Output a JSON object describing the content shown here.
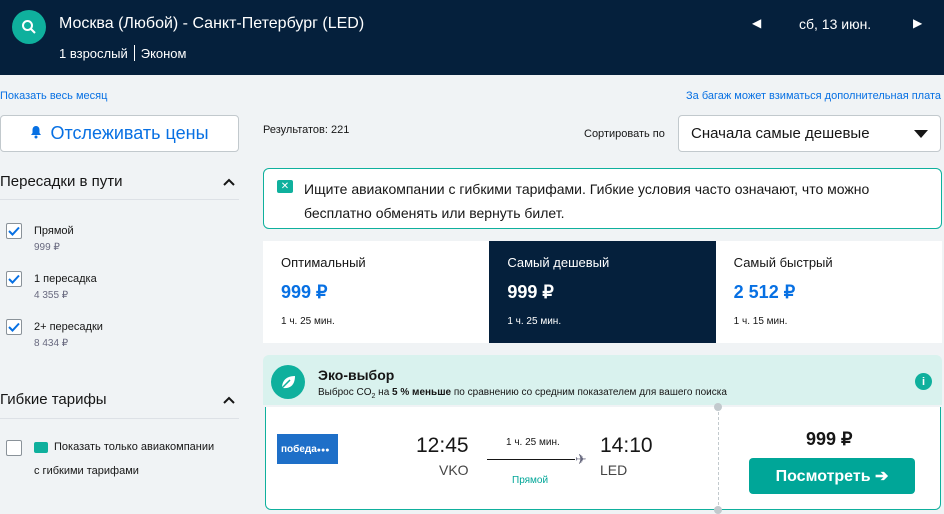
{
  "header": {
    "route": "Москва (Любой) - Санкт-Петербург (LED)",
    "passengers": "1 взрослый",
    "cabin": "Эконом",
    "date": "сб, 13 июн."
  },
  "links": {
    "whole_month": "Показать весь месяц",
    "baggage": "За багаж может взиматься дополнительная плата"
  },
  "track_button": "Отслеживать цены",
  "filters": {
    "stops_title": "Пересадки в пути",
    "options": [
      {
        "label": "Прямой",
        "price": "999 ₽",
        "checked": true
      },
      {
        "label": "1 пересадка",
        "price": "4 355 ₽",
        "checked": true
      },
      {
        "label": "2+ пересадки",
        "price": "8 434 ₽",
        "checked": true
      }
    ],
    "flex_title": "Гибкие тарифы",
    "flex_option_line1": "Показать только авиакомпании",
    "flex_option_line2": "с гибкими тарифами"
  },
  "results": {
    "label": "Результатов: 221"
  },
  "sort": {
    "label": "Сортировать по",
    "value": "Сначала самые дешевые"
  },
  "info_banner": "Ищите авиакомпании с гибкими тарифами. Гибкие условия часто означают, что можно бесплатно обменять или вернуть билет.",
  "tabs": [
    {
      "label": "Оптимальный",
      "price": "999 ₽",
      "duration": "1 ч. 25 мин.",
      "active": false
    },
    {
      "label": "Самый дешевый",
      "price": "999 ₽",
      "duration": "1 ч. 25 мин.",
      "active": true
    },
    {
      "label": "Самый быстрый",
      "price": "2 512 ₽",
      "duration": "1 ч. 15 мин.",
      "active": false
    }
  ],
  "eco": {
    "title": "Эко-выбор",
    "desc_prefix": "Выброс CO",
    "desc_sub": "2",
    "desc_mid": " на ",
    "desc_bold": "5 % меньше",
    "desc_suffix": " по сравнению со средним показателем для вашего поиска"
  },
  "flight": {
    "airline_logo_text": "победа",
    "depart_time": "12:45",
    "depart_airport": "VKO",
    "arrive_time": "14:10",
    "arrive_airport": "LED",
    "duration": "1 ч. 25 мин.",
    "stops": "Прямой",
    "price": "999 ₽",
    "button": "Посмотреть ➔"
  },
  "colors": {
    "header_bg": "#05203c",
    "accent": "#0fb09d",
    "link": "#0770e3",
    "button": "#00a698"
  }
}
